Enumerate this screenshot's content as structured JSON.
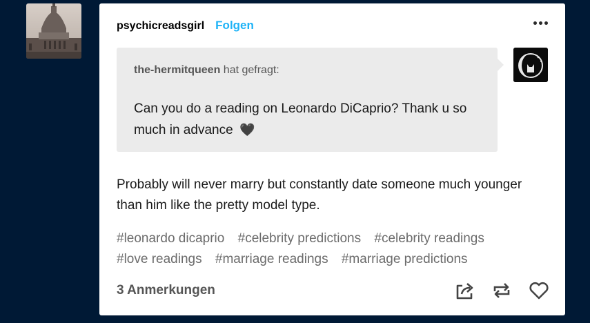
{
  "post": {
    "username": "psychicreadsgirl",
    "follow_label": "Folgen",
    "ask": {
      "asker": "the-hermitqueen",
      "asked_label": "hat gefragt:",
      "question": "Can you do a reading on Leonardo DiCaprio? Thank u so much in advance",
      "emoji": "🖤"
    },
    "answer": "Probably will never marry but constantly date someone much younger than him like the pretty model type.",
    "tags": [
      "#leonardo dicaprio",
      "#celebrity predictions",
      "#celebrity readings",
      "#love readings",
      "#marriage readings",
      "#marriage predictions"
    ],
    "notes_label": "3 Anmerkungen"
  },
  "icons": {
    "more": "more-options-icon",
    "share": "share-icon",
    "reblog": "reblog-icon",
    "like": "heart-icon"
  },
  "colors": {
    "background": "#001935",
    "accent": "#1eb3f7",
    "ask_bg": "#ebebeb"
  }
}
